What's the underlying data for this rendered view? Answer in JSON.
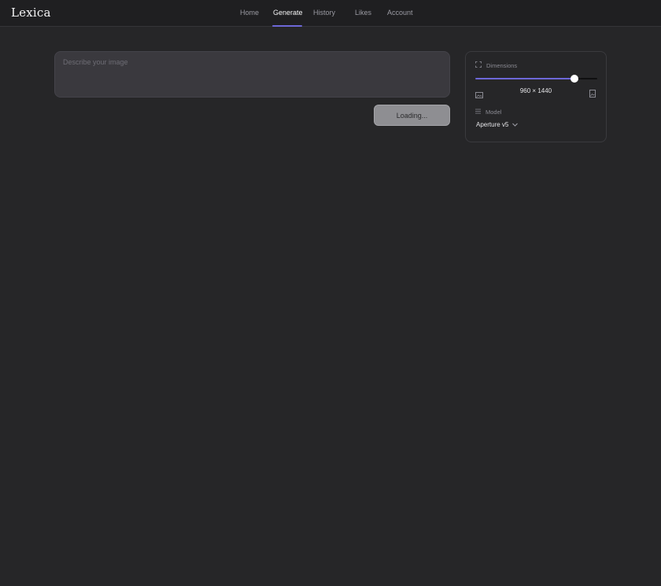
{
  "app": {
    "logo": "Lexica"
  },
  "nav": {
    "items": [
      {
        "label": "Home"
      },
      {
        "label": "Generate"
      },
      {
        "label": "History"
      },
      {
        "label": "Likes"
      },
      {
        "label": "Account"
      }
    ],
    "active": "Generate"
  },
  "prompt": {
    "placeholder": "Describe your image",
    "value": ""
  },
  "generate_button": {
    "label": "Loading..."
  },
  "settings": {
    "dimensions": {
      "label": "Dimensions",
      "value": "960 × 1440",
      "slider_level": 0.81
    },
    "model": {
      "label": "Model",
      "selected": "Aperture v5"
    }
  },
  "colors": {
    "accent": "#6d68d8",
    "background": "#262628",
    "topbar": "#1f1f21",
    "input_bg": "#3a393e"
  }
}
